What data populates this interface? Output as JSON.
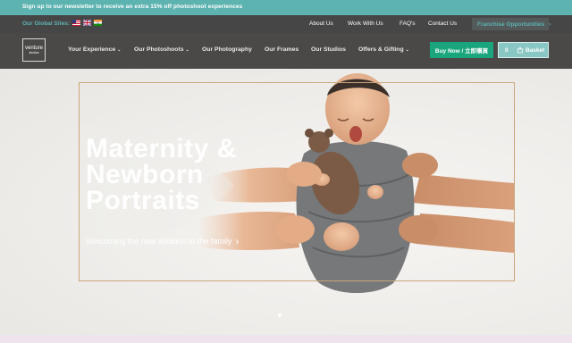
{
  "promo": {
    "text": "Sign up to our newsletter to receive an extra 15% off photoshoot experiences"
  },
  "topbar": {
    "global_sites_label": "Our Global Sites:",
    "flags": [
      "us-flag-icon",
      "uk-flag-icon",
      "india-flag-icon"
    ],
    "links": [
      "About Us",
      "Work With Us",
      "FAQ's",
      "Contact Us"
    ],
    "franchise_label": "Franchise Opportunities",
    "franchise_arrow": "›"
  },
  "nav": {
    "logo_line1": "venture",
    "logo_line2": "studios",
    "items": [
      "Your Experience",
      "Our Photoshoots",
      "Our Photography",
      "Our Frames",
      "Our Studios",
      "Offers & Gifting"
    ],
    "caret": "⌄",
    "buy_now_label": "Buy Now / 立即購買",
    "basket_count": "0",
    "basket_label": "Basket"
  },
  "hero": {
    "headline_line1": "Maternity &",
    "headline_line2": "Newborn",
    "headline_line3": "Portraits",
    "tagline": "Welcoming the new addition to the family",
    "tagline_arrow": "›",
    "slide_count": 1
  },
  "colors": {
    "promo_bar": "#5db3b0",
    "top_bar": "#474646",
    "main_nav": "#4a4948",
    "buy_now": "#1aa67d",
    "basket": "#88c7c3",
    "frame_border": "#c9a77a",
    "hero_background": "#efedea"
  }
}
